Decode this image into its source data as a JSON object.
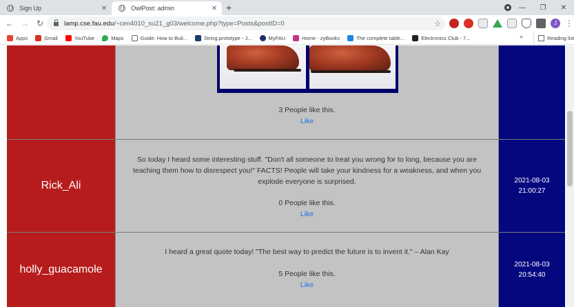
{
  "browser": {
    "tabs": [
      {
        "title": "Sign Up",
        "active": false
      },
      {
        "title": "OwlPost: admin",
        "active": true
      }
    ],
    "new_tab_symbol": "+",
    "url_host": "lamp.cse.fau.edu",
    "url_path": "/~cen4010_su21_g03/welcome.php?type=Posts&postID=0",
    "profile_initial": "J",
    "bookmarks": [
      {
        "label": "Apps",
        "icon": "apps-grid-icon",
        "color": "#ea4335"
      },
      {
        "label": "Gmail",
        "icon": "gmail-icon",
        "color": "#d93025"
      },
      {
        "label": "YouTube",
        "icon": "youtube-icon",
        "color": "#ff0000"
      },
      {
        "label": "Maps",
        "icon": "maps-pin-icon",
        "color": "#34a853"
      },
      {
        "label": "Guide: How to Buil...",
        "icon": "page-icon",
        "color": "#5f6368"
      },
      {
        "label": "String.prototype - J...",
        "icon": "mdn-icon",
        "color": "#1a3c6e"
      },
      {
        "label": "MyFAU",
        "icon": "fau-icon",
        "color": "#1f2d6b"
      },
      {
        "label": "Home - zyBooks",
        "icon": "zybooks-icon",
        "color": "#c13584"
      },
      {
        "label": "The complete table...",
        "icon": "bookmark-flag-icon",
        "color": "#1e88e5"
      },
      {
        "label": "Electronics Club - 7...",
        "icon": "electronics-icon",
        "color": "#202124"
      }
    ],
    "bookmarks_more": "»",
    "reading_list": "Reading list"
  },
  "posts": [
    {
      "author": "",
      "text": "",
      "likes": "3 People like this.",
      "like_label": "Like",
      "date": "",
      "time": "",
      "has_image": true
    },
    {
      "author": "Rick_Ali",
      "text": "So today I heard some interesting stuff. \"Don't all someone to treat you wrong for to long, because you are teaching them how to disrespect you!\" FACTS! People will take your kindness for a weakness, and when you explode everyone is surprised.",
      "likes": "0 People like this.",
      "like_label": "Like",
      "date": "2021-08-03",
      "time": "21:00:27"
    },
    {
      "author": "holly_guacamole",
      "text": "I heard a great quote today! \"The best way to predict the future is to invent it.\" – Alan Kay",
      "likes": "5 People like this.",
      "like_label": "Like",
      "date": "2021-08-03",
      "time": "20:54:40"
    }
  ],
  "colors": {
    "author_bg": "#b71c1c",
    "content_bg": "#c3c3c3",
    "date_bg": "#05077f",
    "like_link": "#1a73e8"
  }
}
